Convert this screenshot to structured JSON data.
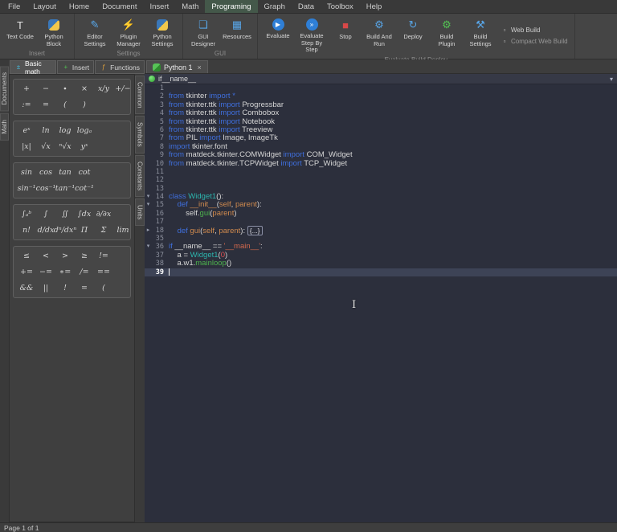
{
  "colors": {
    "kw": "#3f6fdd",
    "plain": "#d6d6d6",
    "cls": "#2cb5ae",
    "fn": "#d08a4e",
    "param": "#d08a4e",
    "str": "#d2684c",
    "num": "#e05252",
    "call": "#4db34d"
  },
  "menubar": {
    "items": [
      "File",
      "Layout",
      "Home",
      "Document",
      "Insert",
      "Math",
      "Programing",
      "Graph",
      "Data",
      "Toolbox",
      "Help"
    ],
    "active": "Programing"
  },
  "ribbon": {
    "groups": [
      {
        "label": "Insert",
        "buttons": [
          {
            "label": "Text Code",
            "icon": "text-code-icon"
          },
          {
            "label": "Python Block",
            "icon": "python-icon"
          }
        ]
      },
      {
        "label": "Settings",
        "buttons": [
          {
            "label": "Editor Settings",
            "icon": "editor-settings-icon"
          },
          {
            "label": "Plugin Manager",
            "icon": "plugin-manager-icon"
          },
          {
            "label": "Python Settings",
            "icon": "python-icon"
          }
        ]
      },
      {
        "label": "GUI",
        "buttons": [
          {
            "label": "GUI Designer",
            "icon": "gui-designer-icon"
          },
          {
            "label": "Resources",
            "icon": "resources-icon"
          }
        ]
      },
      {
        "label": "Evaluate Build Deploy",
        "buttons": [
          {
            "label": "Evaluate",
            "icon": "evaluate-icon"
          },
          {
            "label": "Evaluate Step By Step",
            "icon": "evaluate-step-icon"
          },
          {
            "label": "Stop",
            "icon": "stop-icon"
          },
          {
            "label": "Build And Run",
            "icon": "build-run-icon"
          },
          {
            "label": "Deploy",
            "icon": "deploy-icon"
          },
          {
            "label": "Build Plugin",
            "icon": "build-plugin-icon"
          },
          {
            "label": "Build Settings",
            "icon": "build-settings-icon"
          }
        ],
        "small_buttons": [
          {
            "label": "Web Build",
            "icon": "web-build-icon"
          },
          {
            "label": "Compact Web Build",
            "icon": "compact-web-build-icon"
          }
        ]
      }
    ]
  },
  "left_tabs": [
    "Documents",
    "Math"
  ],
  "palette": {
    "tabs": [
      {
        "label": "Basic math",
        "icon": "basic-math-icon",
        "active": true
      },
      {
        "label": "Insert",
        "icon": "insert-icon",
        "active": false
      },
      {
        "label": "Functions",
        "icon": "functions-icon",
        "active": false
      }
    ],
    "groups": [
      {
        "rows": [
          [
            "+",
            "−",
            "∙",
            "×",
            "x/y",
            "+/−"
          ],
          [
            ":=",
            "=",
            "(",
            ")"
          ]
        ]
      },
      {
        "rows": [
          [
            "eˣ",
            "ln",
            "log",
            "logₐ"
          ],
          [
            "|x|",
            "√x",
            "ⁿ√x",
            "yˣ"
          ]
        ]
      },
      {
        "rows": [
          [
            "sin",
            "cos",
            "tan",
            "cot"
          ],
          [
            "sin⁻¹",
            "cos⁻¹",
            "tan⁻¹",
            "cot⁻¹"
          ]
        ]
      },
      {
        "rows": [
          [
            "∫ₐᵇ",
            "∫",
            "∬",
            "∫dx",
            "∂/∂x"
          ],
          [
            "n!",
            "d/dx",
            "dⁿ/dxⁿ",
            "Π",
            "Σ",
            "lim"
          ]
        ]
      },
      {
        "rows": [
          [
            "≤",
            "<",
            ">",
            "≥",
            "!="
          ],
          [
            "+=",
            "−=",
            "∗=",
            "/=",
            "=="
          ],
          [
            "&&",
            "||",
            "!",
            "=",
            "("
          ]
        ]
      }
    ],
    "side_tabs": [
      "Common",
      "Symbols",
      "Constants",
      "Units"
    ]
  },
  "editor": {
    "doc_tab": "Python 1",
    "breadcrumb": "if__name__",
    "lines": [
      {
        "n": "1",
        "t": []
      },
      {
        "n": "2",
        "t": [
          [
            "k",
            "from"
          ],
          [
            "p",
            " tkinter "
          ],
          [
            "k",
            "import"
          ],
          [
            "p",
            " "
          ],
          [
            "k",
            "*"
          ]
        ]
      },
      {
        "n": "3",
        "t": [
          [
            "k",
            "from"
          ],
          [
            "p",
            " tkinter.ttk "
          ],
          [
            "k",
            "import"
          ],
          [
            "p",
            " Progressbar"
          ]
        ]
      },
      {
        "n": "4",
        "t": [
          [
            "k",
            "from"
          ],
          [
            "p",
            " tkinter.ttk "
          ],
          [
            "k",
            "import"
          ],
          [
            "p",
            " Combobox"
          ]
        ]
      },
      {
        "n": "5",
        "t": [
          [
            "k",
            "from"
          ],
          [
            "p",
            " tkinter.ttk "
          ],
          [
            "k",
            "import"
          ],
          [
            "p",
            " Notebook"
          ]
        ]
      },
      {
        "n": "6",
        "t": [
          [
            "k",
            "from"
          ],
          [
            "p",
            " tkinter.ttk "
          ],
          [
            "k",
            "import"
          ],
          [
            "p",
            " Treeview"
          ]
        ]
      },
      {
        "n": "7",
        "t": [
          [
            "k",
            "from"
          ],
          [
            "p",
            " PIL "
          ],
          [
            "k",
            "import"
          ],
          [
            "p",
            " Image, ImageTk"
          ]
        ]
      },
      {
        "n": "8",
        "t": [
          [
            "k",
            "import"
          ],
          [
            "p",
            " tkinter.font"
          ]
        ]
      },
      {
        "n": "9",
        "t": [
          [
            "k",
            "from"
          ],
          [
            "p",
            " matdeck.tkinter.COMWidget "
          ],
          [
            "k",
            "import"
          ],
          [
            "p",
            " COM_Widget"
          ]
        ]
      },
      {
        "n": "10",
        "t": [
          [
            "k",
            "from"
          ],
          [
            "p",
            " matdeck.tkinter.TCPWidget "
          ],
          [
            "k",
            "import"
          ],
          [
            "p",
            " TCP_Widget"
          ]
        ]
      },
      {
        "n": "11",
        "t": []
      },
      {
        "n": "12",
        "t": []
      },
      {
        "n": "13",
        "t": []
      },
      {
        "n": "14",
        "t": [
          [
            "k",
            "class"
          ],
          [
            "p",
            " "
          ],
          [
            "c",
            "Widget1"
          ],
          [
            "p",
            "():"
          ]
        ],
        "fold": "open"
      },
      {
        "n": "15",
        "t": [
          [
            "p",
            "    "
          ],
          [
            "k",
            "def"
          ],
          [
            "p",
            " "
          ],
          [
            "f",
            "__init__"
          ],
          [
            "p",
            "("
          ],
          [
            "o",
            "self"
          ],
          [
            "p",
            ", "
          ],
          [
            "o",
            "parent"
          ],
          [
            "p",
            "):"
          ]
        ],
        "fold": "open"
      },
      {
        "n": "16",
        "t": [
          [
            "p",
            "        self."
          ],
          [
            "g",
            "gui"
          ],
          [
            "p",
            "("
          ],
          [
            "o",
            "parent"
          ],
          [
            "p",
            ")"
          ]
        ]
      },
      {
        "n": "17",
        "t": []
      },
      {
        "n": "18",
        "t": [
          [
            "p",
            "    "
          ],
          [
            "k",
            "def"
          ],
          [
            "p",
            " "
          ],
          [
            "f",
            "gui"
          ],
          [
            "p",
            "("
          ],
          [
            "o",
            "self"
          ],
          [
            "p",
            ", "
          ],
          [
            "o",
            "parent"
          ],
          [
            "p",
            "): "
          ],
          [
            "b",
            "{...}"
          ]
        ],
        "fold": "closed"
      },
      {
        "n": "35",
        "t": []
      },
      {
        "n": "36",
        "t": [
          [
            "k",
            "if"
          ],
          [
            "p",
            " __name__ == "
          ],
          [
            "s",
            "'__main__'"
          ],
          [
            "p",
            ":"
          ]
        ],
        "fold": "open"
      },
      {
        "n": "37",
        "t": [
          [
            "p",
            "    a = "
          ],
          [
            "c",
            "Widget1"
          ],
          [
            "p",
            "("
          ],
          [
            "n",
            "0"
          ],
          [
            "p",
            ")"
          ]
        ]
      },
      {
        "n": "38",
        "t": [
          [
            "p",
            "    a.w1."
          ],
          [
            "g",
            "mainloop"
          ],
          [
            "p",
            "()"
          ]
        ]
      },
      {
        "n": "39",
        "t": [],
        "current": true
      }
    ]
  },
  "statusbar": "Page 1 of 1"
}
